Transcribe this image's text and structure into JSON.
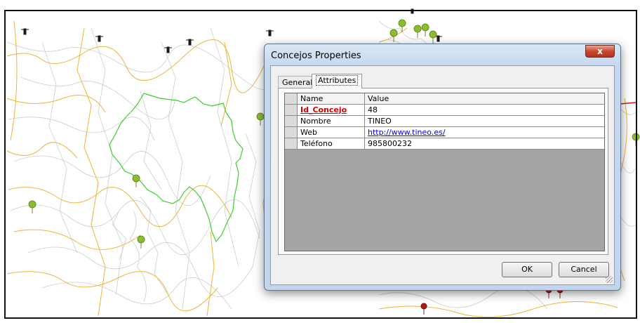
{
  "dialog": {
    "title": "Concejos Properties",
    "close_label": "x",
    "tabs": [
      {
        "label": "General",
        "selected": false
      },
      {
        "label": "Attributes",
        "selected": true
      }
    ],
    "grid": {
      "headers": [
        "Name",
        "Value"
      ],
      "rows": [
        {
          "name": "Id_Concejo",
          "value": "48"
        },
        {
          "name": "Nombre",
          "value": "TINEO"
        },
        {
          "name": "Web",
          "value": "http://www.tineo.es/"
        },
        {
          "name": "Teléfono",
          "value": "985800232"
        }
      ]
    },
    "ok_label": "OK",
    "cancel_label": "Cancel"
  },
  "colors": {
    "selected_boundary": "#3bd12b",
    "roads": "#f0b43c",
    "rivers": "#cfcfcf",
    "highlight_line": "#e01010",
    "key_field": "#d40000",
    "grid_background": "#a5a5a5"
  },
  "map_icons": [
    "lighthouse-icon",
    "tree-marker-icon",
    "red-pin-icon"
  ]
}
